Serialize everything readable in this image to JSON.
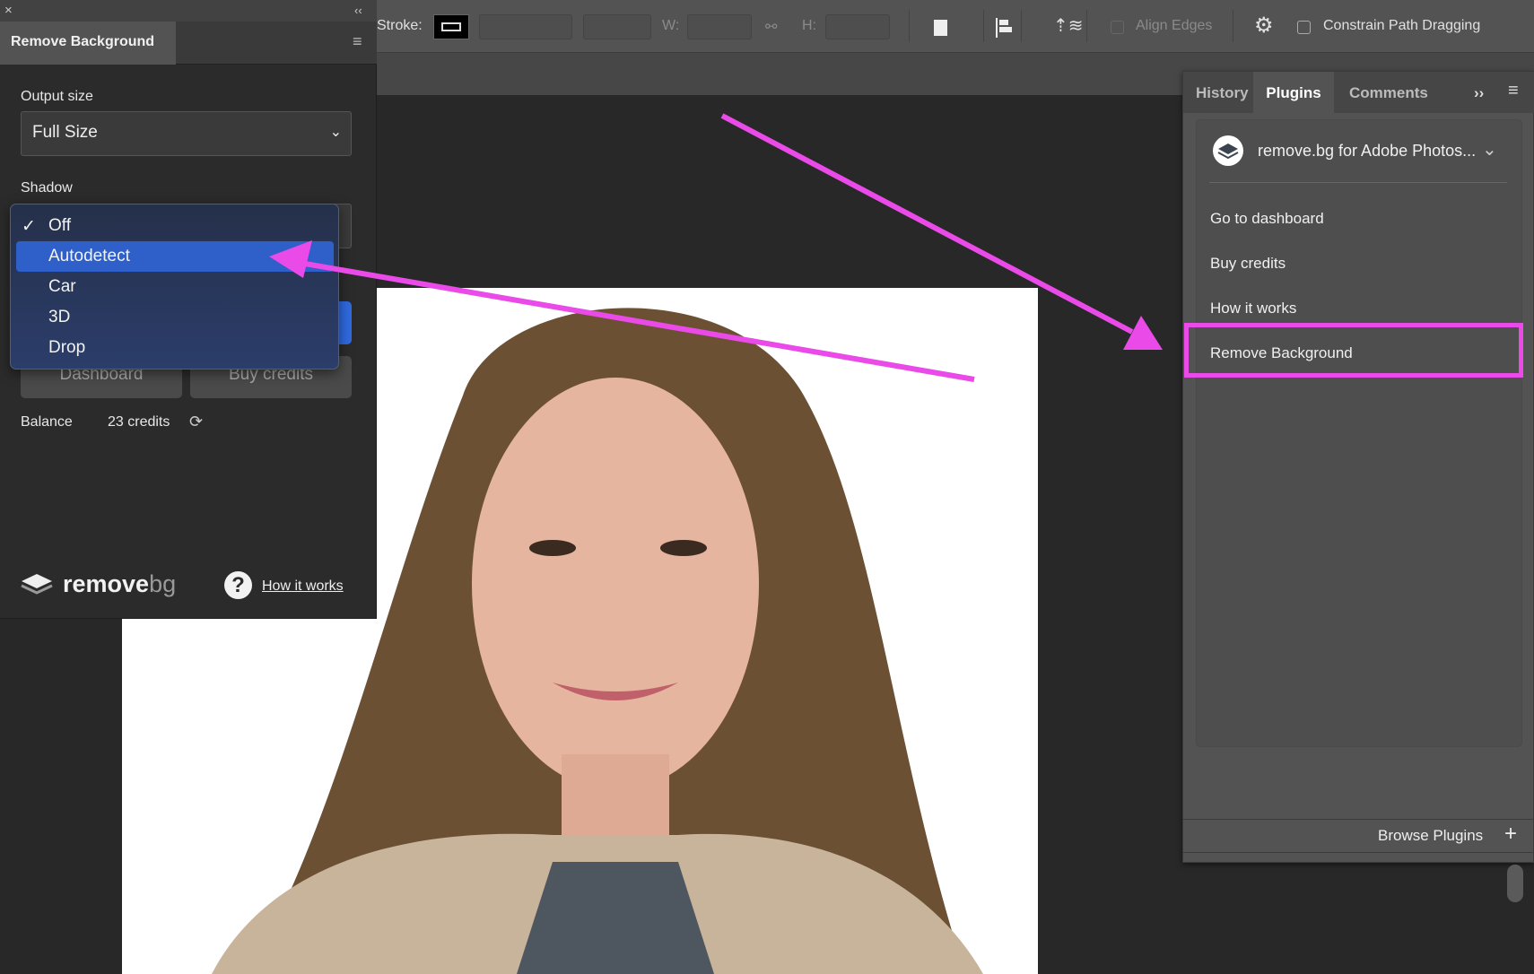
{
  "toolbar": {
    "stroke_label": "Stroke:",
    "w_label": "W:",
    "h_label": "H:",
    "align_edges": "Align Edges",
    "constrain": "Constrain Path Dragging",
    "icons": [
      "stroke-swatch-icon",
      "link-icon",
      "path-operations-icon",
      "path-alignment-icon",
      "path-arrangement-icon",
      "gear-icon"
    ]
  },
  "left_panel": {
    "close": "×",
    "collapse": "‹‹",
    "tab": "Remove Background",
    "output_size_label": "Output size",
    "output_size_value": "Full Size",
    "shadow_label": "Shadow",
    "shadow_options": [
      {
        "label": "Off",
        "checked": true
      },
      {
        "label": "Autodetect",
        "highlighted": true
      },
      {
        "label": "Car"
      },
      {
        "label": "3D"
      },
      {
        "label": "Drop"
      }
    ],
    "check": "✓",
    "dashboard": "Dashboard",
    "buy_credits": "Buy credits",
    "balance_label": "Balance",
    "balance_value": "23 credits",
    "logo_text_a": "remove",
    "logo_text_b": "bg",
    "how_it_works": "How it works"
  },
  "right_panel": {
    "tabs": [
      {
        "label": "History"
      },
      {
        "label": "Plugins",
        "active": true
      },
      {
        "label": "Comments"
      }
    ],
    "expand": "››",
    "plugin_name": "remove.bg for Adobe Photos...",
    "items": [
      "Go to dashboard",
      "Buy credits",
      "How it works",
      "Remove Background"
    ],
    "browse": "Browse Plugins",
    "plus": "+"
  },
  "colors": {
    "annotation": "#e94ae8",
    "menu_highlight": "#2f5fc8"
  }
}
